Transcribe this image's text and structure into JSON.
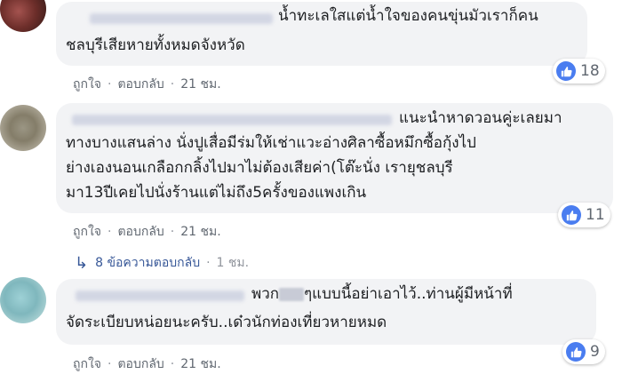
{
  "comments": [
    {
      "author": "",
      "lines": [
        "น้ำทะเลใสแต่น้ำใจของคนขุ่นมัวเราก็คน",
        "ชลบุรีเสียหายทั้งหมดจังหวัด"
      ],
      "reactions": {
        "icon": "like-icon",
        "count": "18"
      },
      "actions": {
        "like": "ถูกใจ",
        "reply": "ตอบกลับ",
        "time": "21 ชม."
      }
    },
    {
      "author": "",
      "lines": [
        "แนะนำหาดวอนคู่ะเลยมา",
        "ทางบางแสนล่าง นั่งปูเสื่อมีร่มให้เช่าแวะอ่างศิลาซื้อหมึกซื้อกุ้งไป",
        "ย่างเองนอนเกลือกกลิ้งไปมาไม่ต้องเสียค่า(โต๊ะนั่ง เรายุชลบุรี",
        "มา13ปีเคยไปนั่งร้านแต่ไม่ถึง5ครั้งของแพงเกิน"
      ],
      "reactions": {
        "icon": "like-icon",
        "count": "11"
      },
      "actions": {
        "like": "ถูกใจ",
        "reply": "ตอบกลับ",
        "time": "21 ชม."
      },
      "replies": {
        "label": "8 ข้อความตอบกลับ",
        "time": "1 ชม."
      }
    },
    {
      "author": "",
      "line1_prefix": "พวก",
      "line1_suffix": "ๆแบบนี้อย่าเอาไว้..ท่านผู้มีหน้าที่",
      "line2": "จัดระเบียบหน่อยนะครับ..เด๋วนักท่องเที่ยวหายหมด",
      "reactions": {
        "icon": "like-icon",
        "count": "9"
      },
      "actions": {
        "like": "ถูกใจ",
        "reply": "ตอบกลับ",
        "time": "21 ชม."
      }
    }
  ],
  "colors": {
    "bubble": "#f2f3f5",
    "like": "#4a7df0",
    "link": "#385898",
    "meta": "#606770"
  }
}
